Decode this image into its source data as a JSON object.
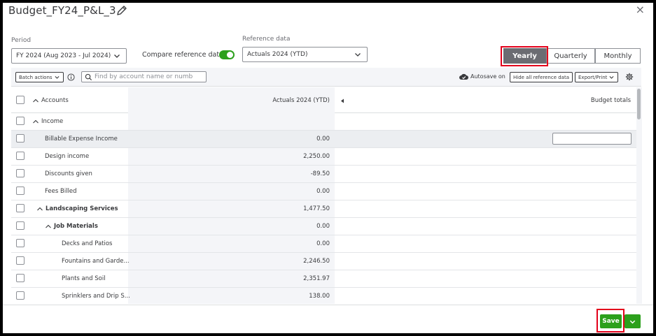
{
  "header": {
    "title": "Budget_FY24_P&L_3",
    "edit_icon": "pencil-icon",
    "close_label": "×"
  },
  "period": {
    "label": "Period",
    "value": "FY 2024 (Aug 2023 - Jul 2024)"
  },
  "compare": {
    "label": "Compare reference data",
    "enabled": true
  },
  "reference": {
    "label": "Reference data",
    "value": "Actuals 2024 (YTD)"
  },
  "view_toggle": {
    "yearly": "Yearly",
    "quarterly": "Quarterly",
    "monthly": "Monthly",
    "selected": "Yearly"
  },
  "toolbar": {
    "batch_actions": "Batch actions",
    "search_placeholder": "Find by account name or numb",
    "autosave": "Autosave on",
    "hide_reference": "Hide all reference data",
    "export_print": "Export/Print"
  },
  "table": {
    "col_accounts": "Accounts",
    "col_reference": "Actuals 2024 (YTD)",
    "col_budget": "Budget totals",
    "rows": [
      {
        "account": "Income",
        "value": ""
      },
      {
        "account": "Billable Expense Income",
        "value": "0.00"
      },
      {
        "account": "Design income",
        "value": "2,250.00"
      },
      {
        "account": "Discounts given",
        "value": "-89.50"
      },
      {
        "account": "Fees Billed",
        "value": "0.00"
      },
      {
        "account": "Landscaping Services",
        "value": "1,477.50"
      },
      {
        "account": "Job Materials",
        "value": "0.00"
      },
      {
        "account": "Decks and Patios",
        "value": "0.00"
      },
      {
        "account": "Fountains and Garde...",
        "value": "2,246.50"
      },
      {
        "account": "Plants and Soil",
        "value": "2,351.97"
      },
      {
        "account": "Sprinklers and Drip S...",
        "value": "138.00"
      }
    ]
  },
  "footer": {
    "save": "Save"
  },
  "colors": {
    "accent_green": "#2ca01c",
    "highlight_red": "#e3001b",
    "segment_active": "#6b6c72"
  }
}
